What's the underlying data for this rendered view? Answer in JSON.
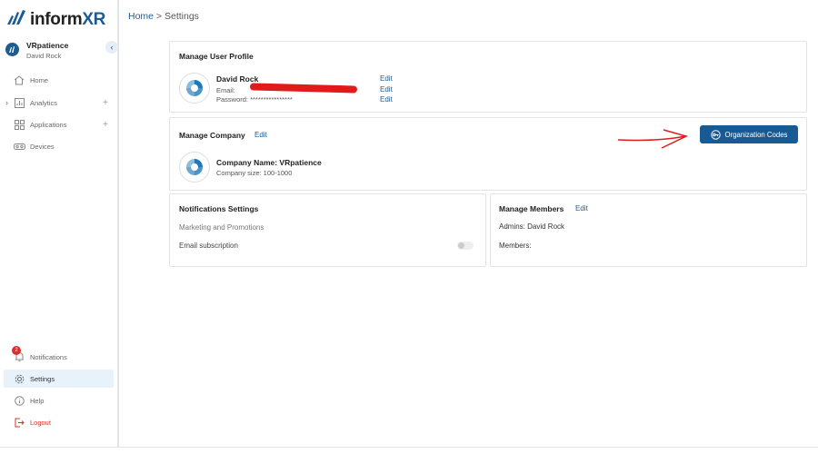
{
  "logo": {
    "brand_a": "inform",
    "brand_b": "XR"
  },
  "account": {
    "name": "VRpatience",
    "user": "David Rock",
    "collapse_glyph": "‹"
  },
  "nav": {
    "home": "Home",
    "analytics": "Analytics",
    "applications": "Applications",
    "devices": "Devices",
    "notifications": "Notifications",
    "notifications_count": "2",
    "settings": "Settings",
    "help": "Help",
    "logout": "Logout",
    "plus": "+"
  },
  "breadcrumb": {
    "home": "Home",
    "separator": " > ",
    "current": "Settings"
  },
  "profile": {
    "title": "Manage User Profile",
    "name": "David Rock",
    "email_label": "Email:",
    "password_label": "Password: ****************",
    "edit": "Edit"
  },
  "company": {
    "title": "Manage Company",
    "edit": "Edit",
    "name": "Company Name: VRpatience",
    "size": "Company size: 100-1000",
    "org_codes_button": "Organization Codes"
  },
  "notifications_settings": {
    "title": "Notifications Settings",
    "marketing": "Marketing and Promotions",
    "email_sub": "Email subscription",
    "email_sub_enabled": false
  },
  "members": {
    "title": "Manage Members",
    "edit": "Edit",
    "admins": "Admins:  David Rock",
    "members": "Members:"
  },
  "colors": {
    "accent": "#1d5c93",
    "button": "#185a93",
    "annotation": "#e11b1b"
  }
}
